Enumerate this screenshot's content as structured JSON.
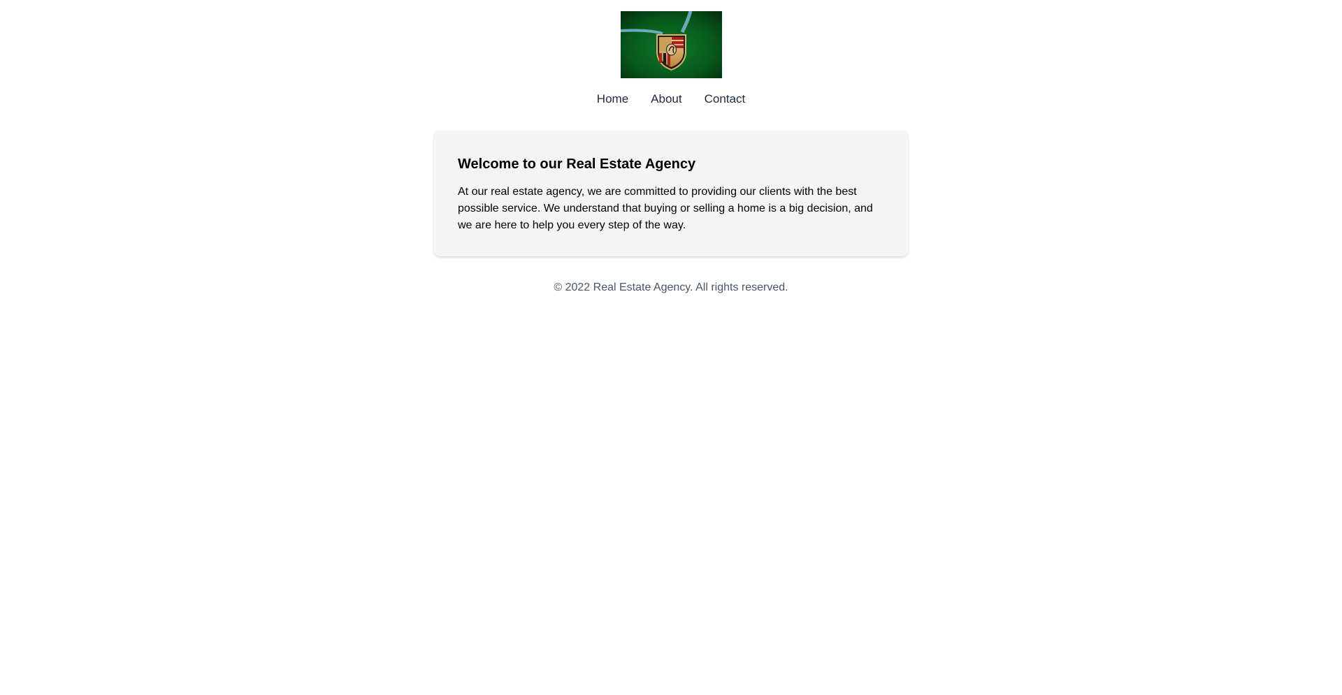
{
  "header": {
    "logo_icon": "porsche-crest-logo",
    "nav": [
      {
        "label": "Home"
      },
      {
        "label": "About"
      },
      {
        "label": "Contact"
      }
    ]
  },
  "main": {
    "title": "Welcome to our Real Estate Agency",
    "body": "At our real estate agency, we are committed to providing our clients with the best possible service. We understand that buying or selling a home is a big decision, and we are here to help you every step of the way."
  },
  "footer": {
    "text": "© 2022 Real Estate Agency. All rights reserved."
  },
  "colors": {
    "card_background": "#f3f4f6",
    "nav_text": "#1f2937",
    "footer_text": "#4b5563",
    "logo_background": "#0a5a1a"
  }
}
